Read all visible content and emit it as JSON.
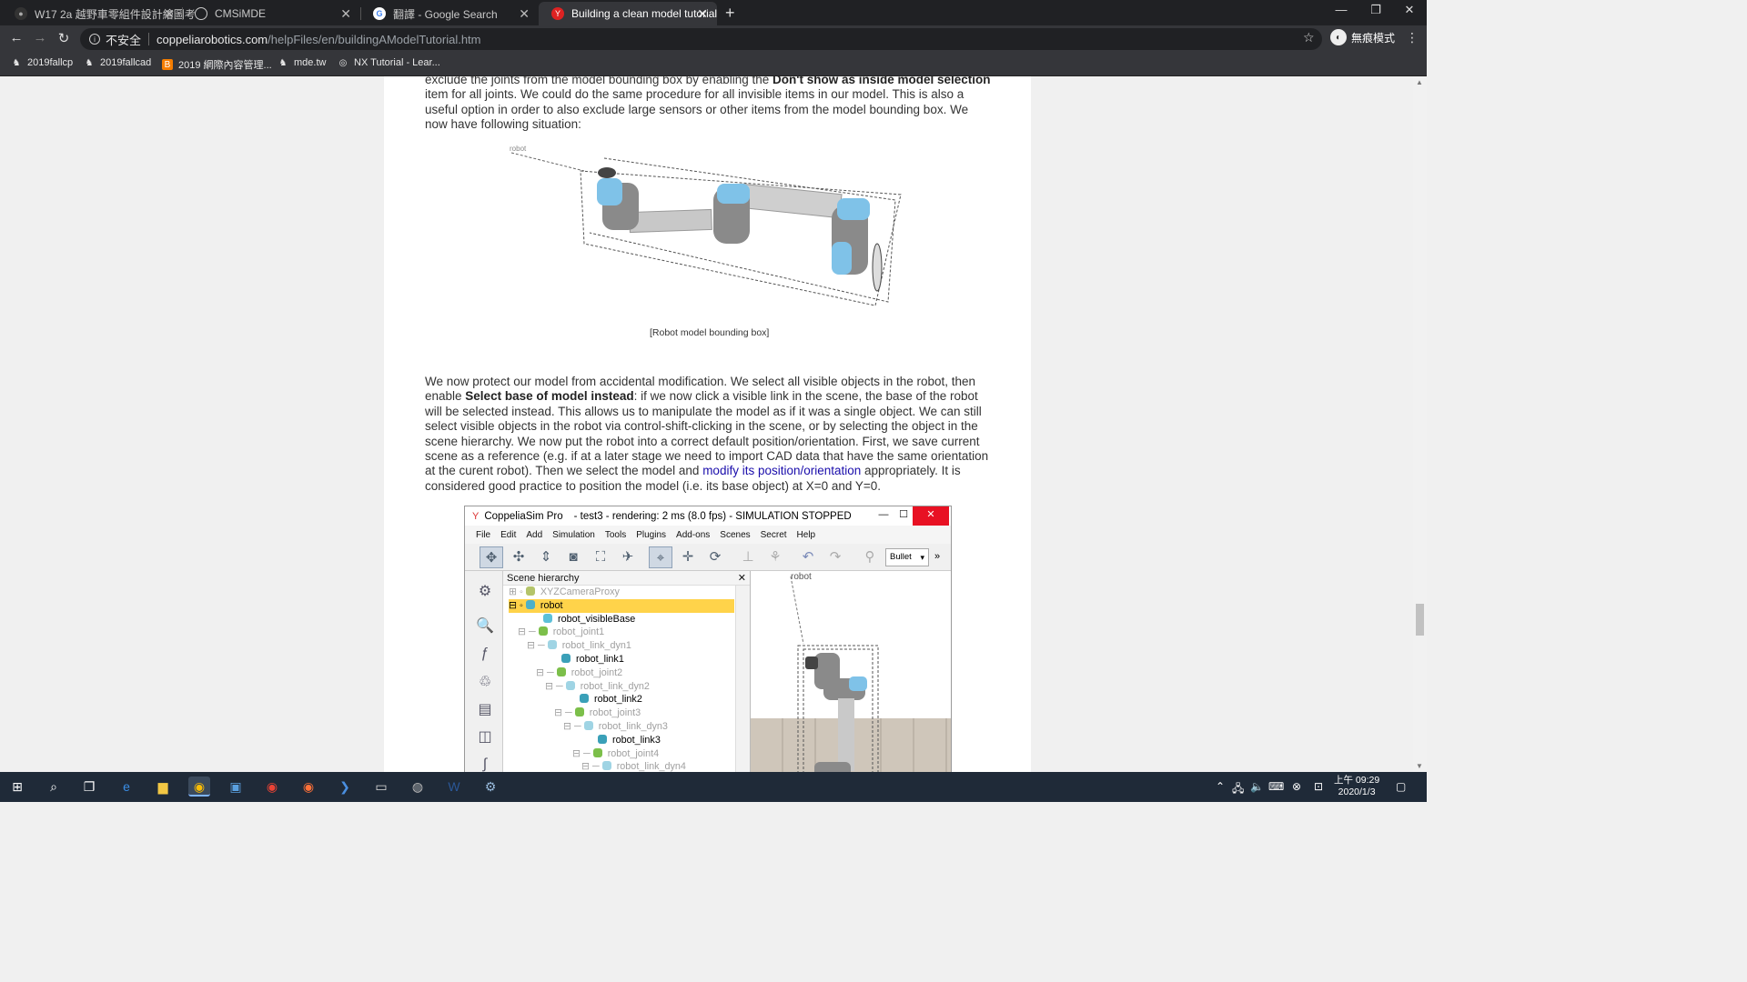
{
  "browser": {
    "tabs": [
      {
        "title": "W17 2a 越野車零組件設計繪圖考",
        "active": false
      },
      {
        "title": "CMSiMDE",
        "active": false
      },
      {
        "title": "翻譯 - Google Search",
        "active": false
      },
      {
        "title": "Building a clean model tutorial",
        "active": true
      }
    ],
    "url_security": "不安全",
    "url_host": "coppeliarobotics.com",
    "url_path": "/helpFiles/en/buildingAModelTutorial.htm",
    "profile_label": "無痕模式",
    "bookmarks": [
      "2019fallcp",
      "2019fallcad",
      "2019 網際內容管理...",
      "mde.tw",
      "NX Tutorial - Lear..."
    ]
  },
  "article": {
    "para1_pre": "exclude the joints from the model bounding box by enabling the ",
    "para1_bold": "Don't show as inside model selection",
    "para1_post": " item for all joints. We could do the same procedure for all invisible items in our model. This is also a useful option in order to also exclude large sensors or other items from the model bounding box. We now have following situation:",
    "figure_label": "robot",
    "caption": "[Robot model bounding box]",
    "para2_pre": "We now protect our model from accidental modification. We select all visible objects in the robot, then enable ",
    "para2_bold": "Select base of model instead",
    "para2_mid": ": if we now click a visible link in the scene, the base of the robot will be selected instead. This allows us to manipulate the model as if it was a single object. We can still select visible objects in the robot via control-shift-clicking in the scene, or by selecting the object in the scene hierarchy. We now put the robot into a correct default position/orientation. First, we save current scene as a reference (e.g. if at a later stage we need to import CAD data that have the same orientation at the curent robot). Then we select the model and ",
    "para2_link": "modify its position/orientation",
    "para2_post": " appropriately. It is considered good practice to position the model (i.e. its base object) at X=0 and Y=0."
  },
  "app": {
    "title_app": "CoppeliaSim Pro",
    "title_rest": "- test3 - rendering: 2 ms (8.0 fps) - SIMULATION STOPPED",
    "menu": [
      "File",
      "Edit",
      "Add",
      "Simulation",
      "Tools",
      "Plugins",
      "Add-ons",
      "Scenes",
      "Secret",
      "Help"
    ],
    "engine": "Bullet",
    "hierarchy_title": "Scene hierarchy",
    "view_label": "robot",
    "nodes": [
      {
        "label": "XYZCameraProxy",
        "dim": true,
        "sel": false
      },
      {
        "label": "robot",
        "dim": false,
        "sel": true
      },
      {
        "label": "robot_visibleBase",
        "dim": false,
        "sel": false
      },
      {
        "label": "robot_joint1",
        "dim": true,
        "sel": false
      },
      {
        "label": "robot_link_dyn1",
        "dim": true,
        "sel": false
      },
      {
        "label": "robot_link1",
        "dim": false,
        "sel": false
      },
      {
        "label": "robot_joint2",
        "dim": true,
        "sel": false
      },
      {
        "label": "robot_link_dyn2",
        "dim": true,
        "sel": false
      },
      {
        "label": "robot_link2",
        "dim": false,
        "sel": false
      },
      {
        "label": "robot_joint3",
        "dim": true,
        "sel": false
      },
      {
        "label": "robot_link_dyn3",
        "dim": true,
        "sel": false
      },
      {
        "label": "robot_link3",
        "dim": false,
        "sel": false
      },
      {
        "label": "robot_joint4",
        "dim": true,
        "sel": false
      },
      {
        "label": "robot_link_dyn4",
        "dim": true,
        "sel": false
      }
    ]
  },
  "taskbar": {
    "clock_time": "上午 09:29",
    "clock_date": "2020/1/3"
  }
}
